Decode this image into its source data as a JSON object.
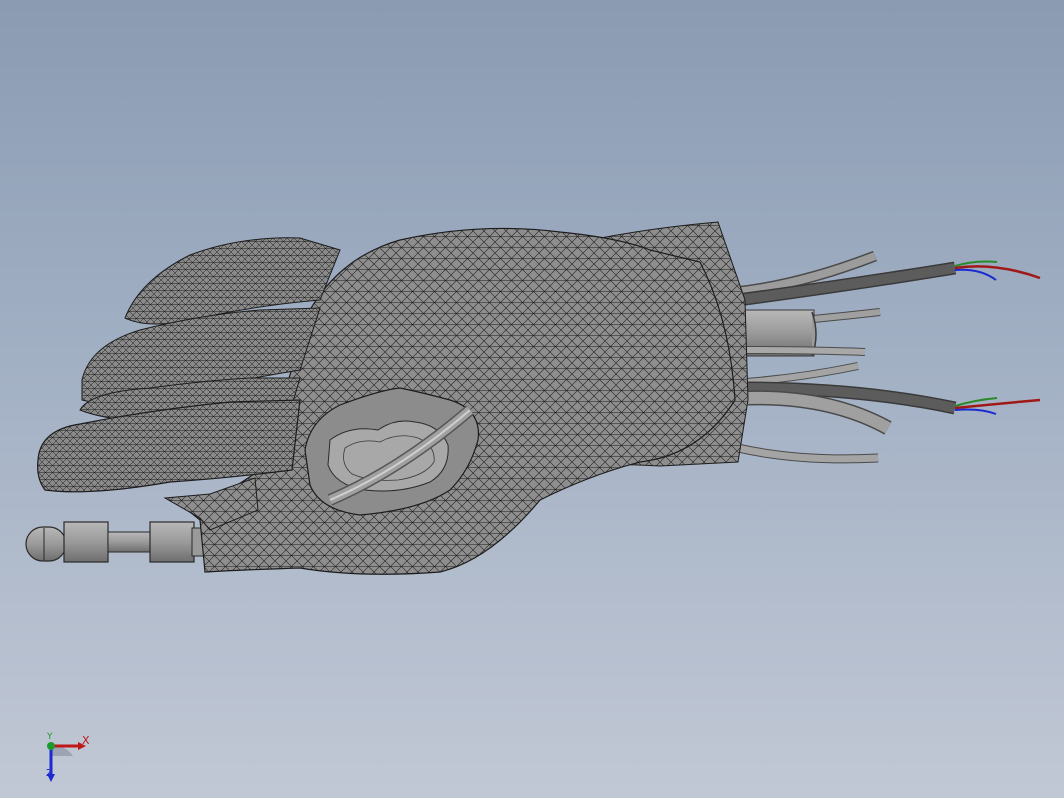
{
  "viewport": {
    "background_top": "#8a9bb2",
    "background_bottom": "#c1c8d5"
  },
  "model": {
    "name": "robotic-hand-mesh",
    "mesh_color": "#8e8e8e",
    "edge_color": "#1c1c1c",
    "tube_color": "#9b9b9b",
    "cable_color": "#5a5a5a",
    "wire_colors": [
      "#2a8a2a",
      "#c01818",
      "#1a2ad0"
    ]
  },
  "triad": {
    "x_label": "X",
    "y_label": "Y",
    "z_label": "Z",
    "x_color": "#c01818",
    "y_color": "#1a9a2a",
    "z_color": "#1a2ad0"
  }
}
